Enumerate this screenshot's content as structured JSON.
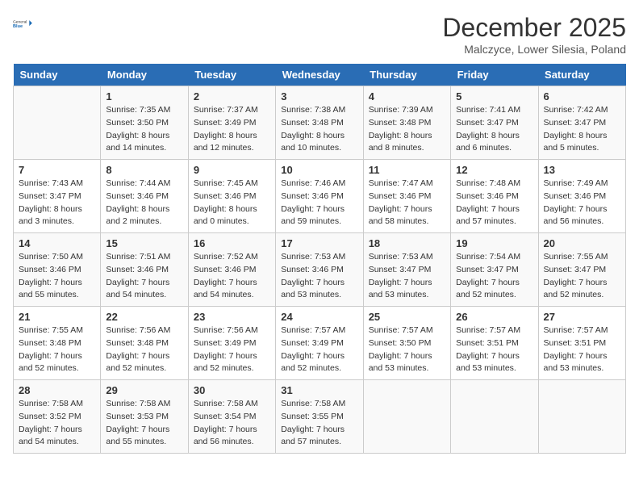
{
  "header": {
    "logo_general": "General",
    "logo_blue": "Blue",
    "month": "December 2025",
    "location": "Malczyce, Lower Silesia, Poland"
  },
  "weekdays": [
    "Sunday",
    "Monday",
    "Tuesday",
    "Wednesday",
    "Thursday",
    "Friday",
    "Saturday"
  ],
  "weeks": [
    [
      {
        "day": "",
        "sunrise": "",
        "sunset": "",
        "daylight": ""
      },
      {
        "day": "1",
        "sunrise": "Sunrise: 7:35 AM",
        "sunset": "Sunset: 3:50 PM",
        "daylight": "Daylight: 8 hours and 14 minutes."
      },
      {
        "day": "2",
        "sunrise": "Sunrise: 7:37 AM",
        "sunset": "Sunset: 3:49 PM",
        "daylight": "Daylight: 8 hours and 12 minutes."
      },
      {
        "day": "3",
        "sunrise": "Sunrise: 7:38 AM",
        "sunset": "Sunset: 3:48 PM",
        "daylight": "Daylight: 8 hours and 10 minutes."
      },
      {
        "day": "4",
        "sunrise": "Sunrise: 7:39 AM",
        "sunset": "Sunset: 3:48 PM",
        "daylight": "Daylight: 8 hours and 8 minutes."
      },
      {
        "day": "5",
        "sunrise": "Sunrise: 7:41 AM",
        "sunset": "Sunset: 3:47 PM",
        "daylight": "Daylight: 8 hours and 6 minutes."
      },
      {
        "day": "6",
        "sunrise": "Sunrise: 7:42 AM",
        "sunset": "Sunset: 3:47 PM",
        "daylight": "Daylight: 8 hours and 5 minutes."
      }
    ],
    [
      {
        "day": "7",
        "sunrise": "Sunrise: 7:43 AM",
        "sunset": "Sunset: 3:47 PM",
        "daylight": "Daylight: 8 hours and 3 minutes."
      },
      {
        "day": "8",
        "sunrise": "Sunrise: 7:44 AM",
        "sunset": "Sunset: 3:46 PM",
        "daylight": "Daylight: 8 hours and 2 minutes."
      },
      {
        "day": "9",
        "sunrise": "Sunrise: 7:45 AM",
        "sunset": "Sunset: 3:46 PM",
        "daylight": "Daylight: 8 hours and 0 minutes."
      },
      {
        "day": "10",
        "sunrise": "Sunrise: 7:46 AM",
        "sunset": "Sunset: 3:46 PM",
        "daylight": "Daylight: 7 hours and 59 minutes."
      },
      {
        "day": "11",
        "sunrise": "Sunrise: 7:47 AM",
        "sunset": "Sunset: 3:46 PM",
        "daylight": "Daylight: 7 hours and 58 minutes."
      },
      {
        "day": "12",
        "sunrise": "Sunrise: 7:48 AM",
        "sunset": "Sunset: 3:46 PM",
        "daylight": "Daylight: 7 hours and 57 minutes."
      },
      {
        "day": "13",
        "sunrise": "Sunrise: 7:49 AM",
        "sunset": "Sunset: 3:46 PM",
        "daylight": "Daylight: 7 hours and 56 minutes."
      }
    ],
    [
      {
        "day": "14",
        "sunrise": "Sunrise: 7:50 AM",
        "sunset": "Sunset: 3:46 PM",
        "daylight": "Daylight: 7 hours and 55 minutes."
      },
      {
        "day": "15",
        "sunrise": "Sunrise: 7:51 AM",
        "sunset": "Sunset: 3:46 PM",
        "daylight": "Daylight: 7 hours and 54 minutes."
      },
      {
        "day": "16",
        "sunrise": "Sunrise: 7:52 AM",
        "sunset": "Sunset: 3:46 PM",
        "daylight": "Daylight: 7 hours and 54 minutes."
      },
      {
        "day": "17",
        "sunrise": "Sunrise: 7:53 AM",
        "sunset": "Sunset: 3:46 PM",
        "daylight": "Daylight: 7 hours and 53 minutes."
      },
      {
        "day": "18",
        "sunrise": "Sunrise: 7:53 AM",
        "sunset": "Sunset: 3:47 PM",
        "daylight": "Daylight: 7 hours and 53 minutes."
      },
      {
        "day": "19",
        "sunrise": "Sunrise: 7:54 AM",
        "sunset": "Sunset: 3:47 PM",
        "daylight": "Daylight: 7 hours and 52 minutes."
      },
      {
        "day": "20",
        "sunrise": "Sunrise: 7:55 AM",
        "sunset": "Sunset: 3:47 PM",
        "daylight": "Daylight: 7 hours and 52 minutes."
      }
    ],
    [
      {
        "day": "21",
        "sunrise": "Sunrise: 7:55 AM",
        "sunset": "Sunset: 3:48 PM",
        "daylight": "Daylight: 7 hours and 52 minutes."
      },
      {
        "day": "22",
        "sunrise": "Sunrise: 7:56 AM",
        "sunset": "Sunset: 3:48 PM",
        "daylight": "Daylight: 7 hours and 52 minutes."
      },
      {
        "day": "23",
        "sunrise": "Sunrise: 7:56 AM",
        "sunset": "Sunset: 3:49 PM",
        "daylight": "Daylight: 7 hours and 52 minutes."
      },
      {
        "day": "24",
        "sunrise": "Sunrise: 7:57 AM",
        "sunset": "Sunset: 3:49 PM",
        "daylight": "Daylight: 7 hours and 52 minutes."
      },
      {
        "day": "25",
        "sunrise": "Sunrise: 7:57 AM",
        "sunset": "Sunset: 3:50 PM",
        "daylight": "Daylight: 7 hours and 53 minutes."
      },
      {
        "day": "26",
        "sunrise": "Sunrise: 7:57 AM",
        "sunset": "Sunset: 3:51 PM",
        "daylight": "Daylight: 7 hours and 53 minutes."
      },
      {
        "day": "27",
        "sunrise": "Sunrise: 7:57 AM",
        "sunset": "Sunset: 3:51 PM",
        "daylight": "Daylight: 7 hours and 53 minutes."
      }
    ],
    [
      {
        "day": "28",
        "sunrise": "Sunrise: 7:58 AM",
        "sunset": "Sunset: 3:52 PM",
        "daylight": "Daylight: 7 hours and 54 minutes."
      },
      {
        "day": "29",
        "sunrise": "Sunrise: 7:58 AM",
        "sunset": "Sunset: 3:53 PM",
        "daylight": "Daylight: 7 hours and 55 minutes."
      },
      {
        "day": "30",
        "sunrise": "Sunrise: 7:58 AM",
        "sunset": "Sunset: 3:54 PM",
        "daylight": "Daylight: 7 hours and 56 minutes."
      },
      {
        "day": "31",
        "sunrise": "Sunrise: 7:58 AM",
        "sunset": "Sunset: 3:55 PM",
        "daylight": "Daylight: 7 hours and 57 minutes."
      },
      {
        "day": "",
        "sunrise": "",
        "sunset": "",
        "daylight": ""
      },
      {
        "day": "",
        "sunrise": "",
        "sunset": "",
        "daylight": ""
      },
      {
        "day": "",
        "sunrise": "",
        "sunset": "",
        "daylight": ""
      }
    ]
  ]
}
